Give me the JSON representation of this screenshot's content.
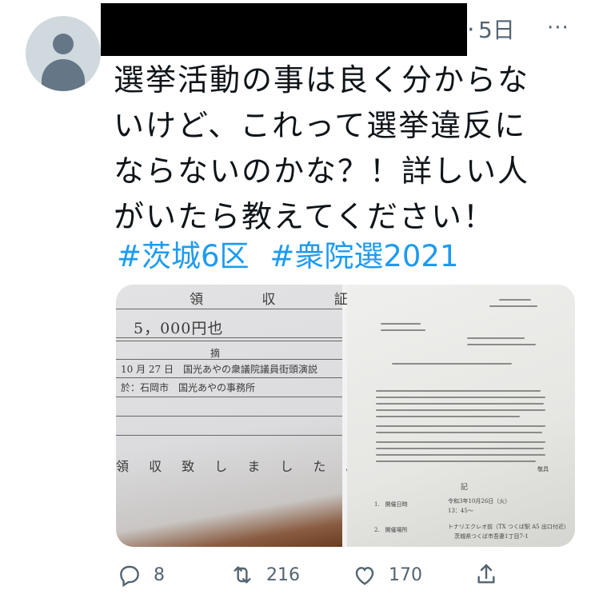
{
  "tweet": {
    "time": "5日",
    "more_glyph": "···",
    "text_lines": [
      "選挙活動の事は良く分からな",
      "いけど、これって選挙違反に",
      "ならないのかな？！詳しい人",
      "がいたら教えてください！"
    ],
    "hashtags": [
      "#茨城6区",
      "#衆院選2021"
    ]
  },
  "receipt": {
    "title": "領 収 証",
    "amount": "5，000円也",
    "tekiyo": "摘",
    "row1": "10 月 27 日　国光あやの衆議院議員街頭演説",
    "row2": "於：石岡市　国光あやの事務所",
    "footer": "領 収 致 し ま し た 。"
  },
  "document": {
    "item1": "1.　開催日時",
    "item1_value": "令和3年10月26日（火）",
    "item1_time": "13：45～",
    "item2": "2.　開催場所",
    "item2_value": "トナリエクレオ前（TX つくば駅 A5 出口付近）",
    "item2_addr": "茨城県つくば市吾妻1丁目7-1",
    "ki": "記",
    "keigu": "敬具"
  },
  "actions": {
    "reply_count": "8",
    "retweet_count": "216",
    "like_count": "170"
  },
  "colors": {
    "accent": "#1d9bf0",
    "secondary_text": "#536471"
  }
}
